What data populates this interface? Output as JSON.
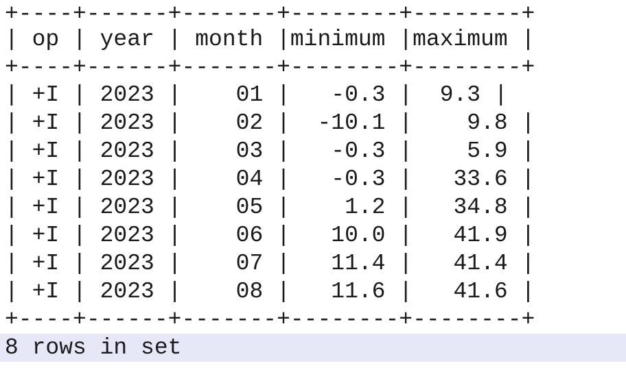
{
  "result_table": {
    "border_lines": {
      "top": "+----+------+-------+--------+--------+",
      "header_separator": "+----+------+-------+--------+--------+",
      "bottom": "+----+------+-------+--------+--------+"
    },
    "header_line": "| op | year | month |minimum |maximum |",
    "rows": [
      "| +I | 2023 |    01 |   -0.3 |  9.3 |",
      "| +I | 2023 |    02 |  -10.1 |    9.8 |",
      "| +I | 2023 |    03 |   -0.3 |    5.9 |",
      "| +I | 2023 |    04 |   -0.3 |   33.6 |",
      "| +I | 2023 |    05 |    1.2 |   34.8 |",
      "| +I | 2023 |    06 |   10.0 |   41.9 |",
      "| +I | 2023 |    07 |   11.4 |   41.4 |",
      "| +I | 2023 |    08 |   11.6 |   41.6 |"
    ]
  },
  "status": {
    "text": "8 rows in set",
    "highlight_color": "#e6e7f7"
  }
}
